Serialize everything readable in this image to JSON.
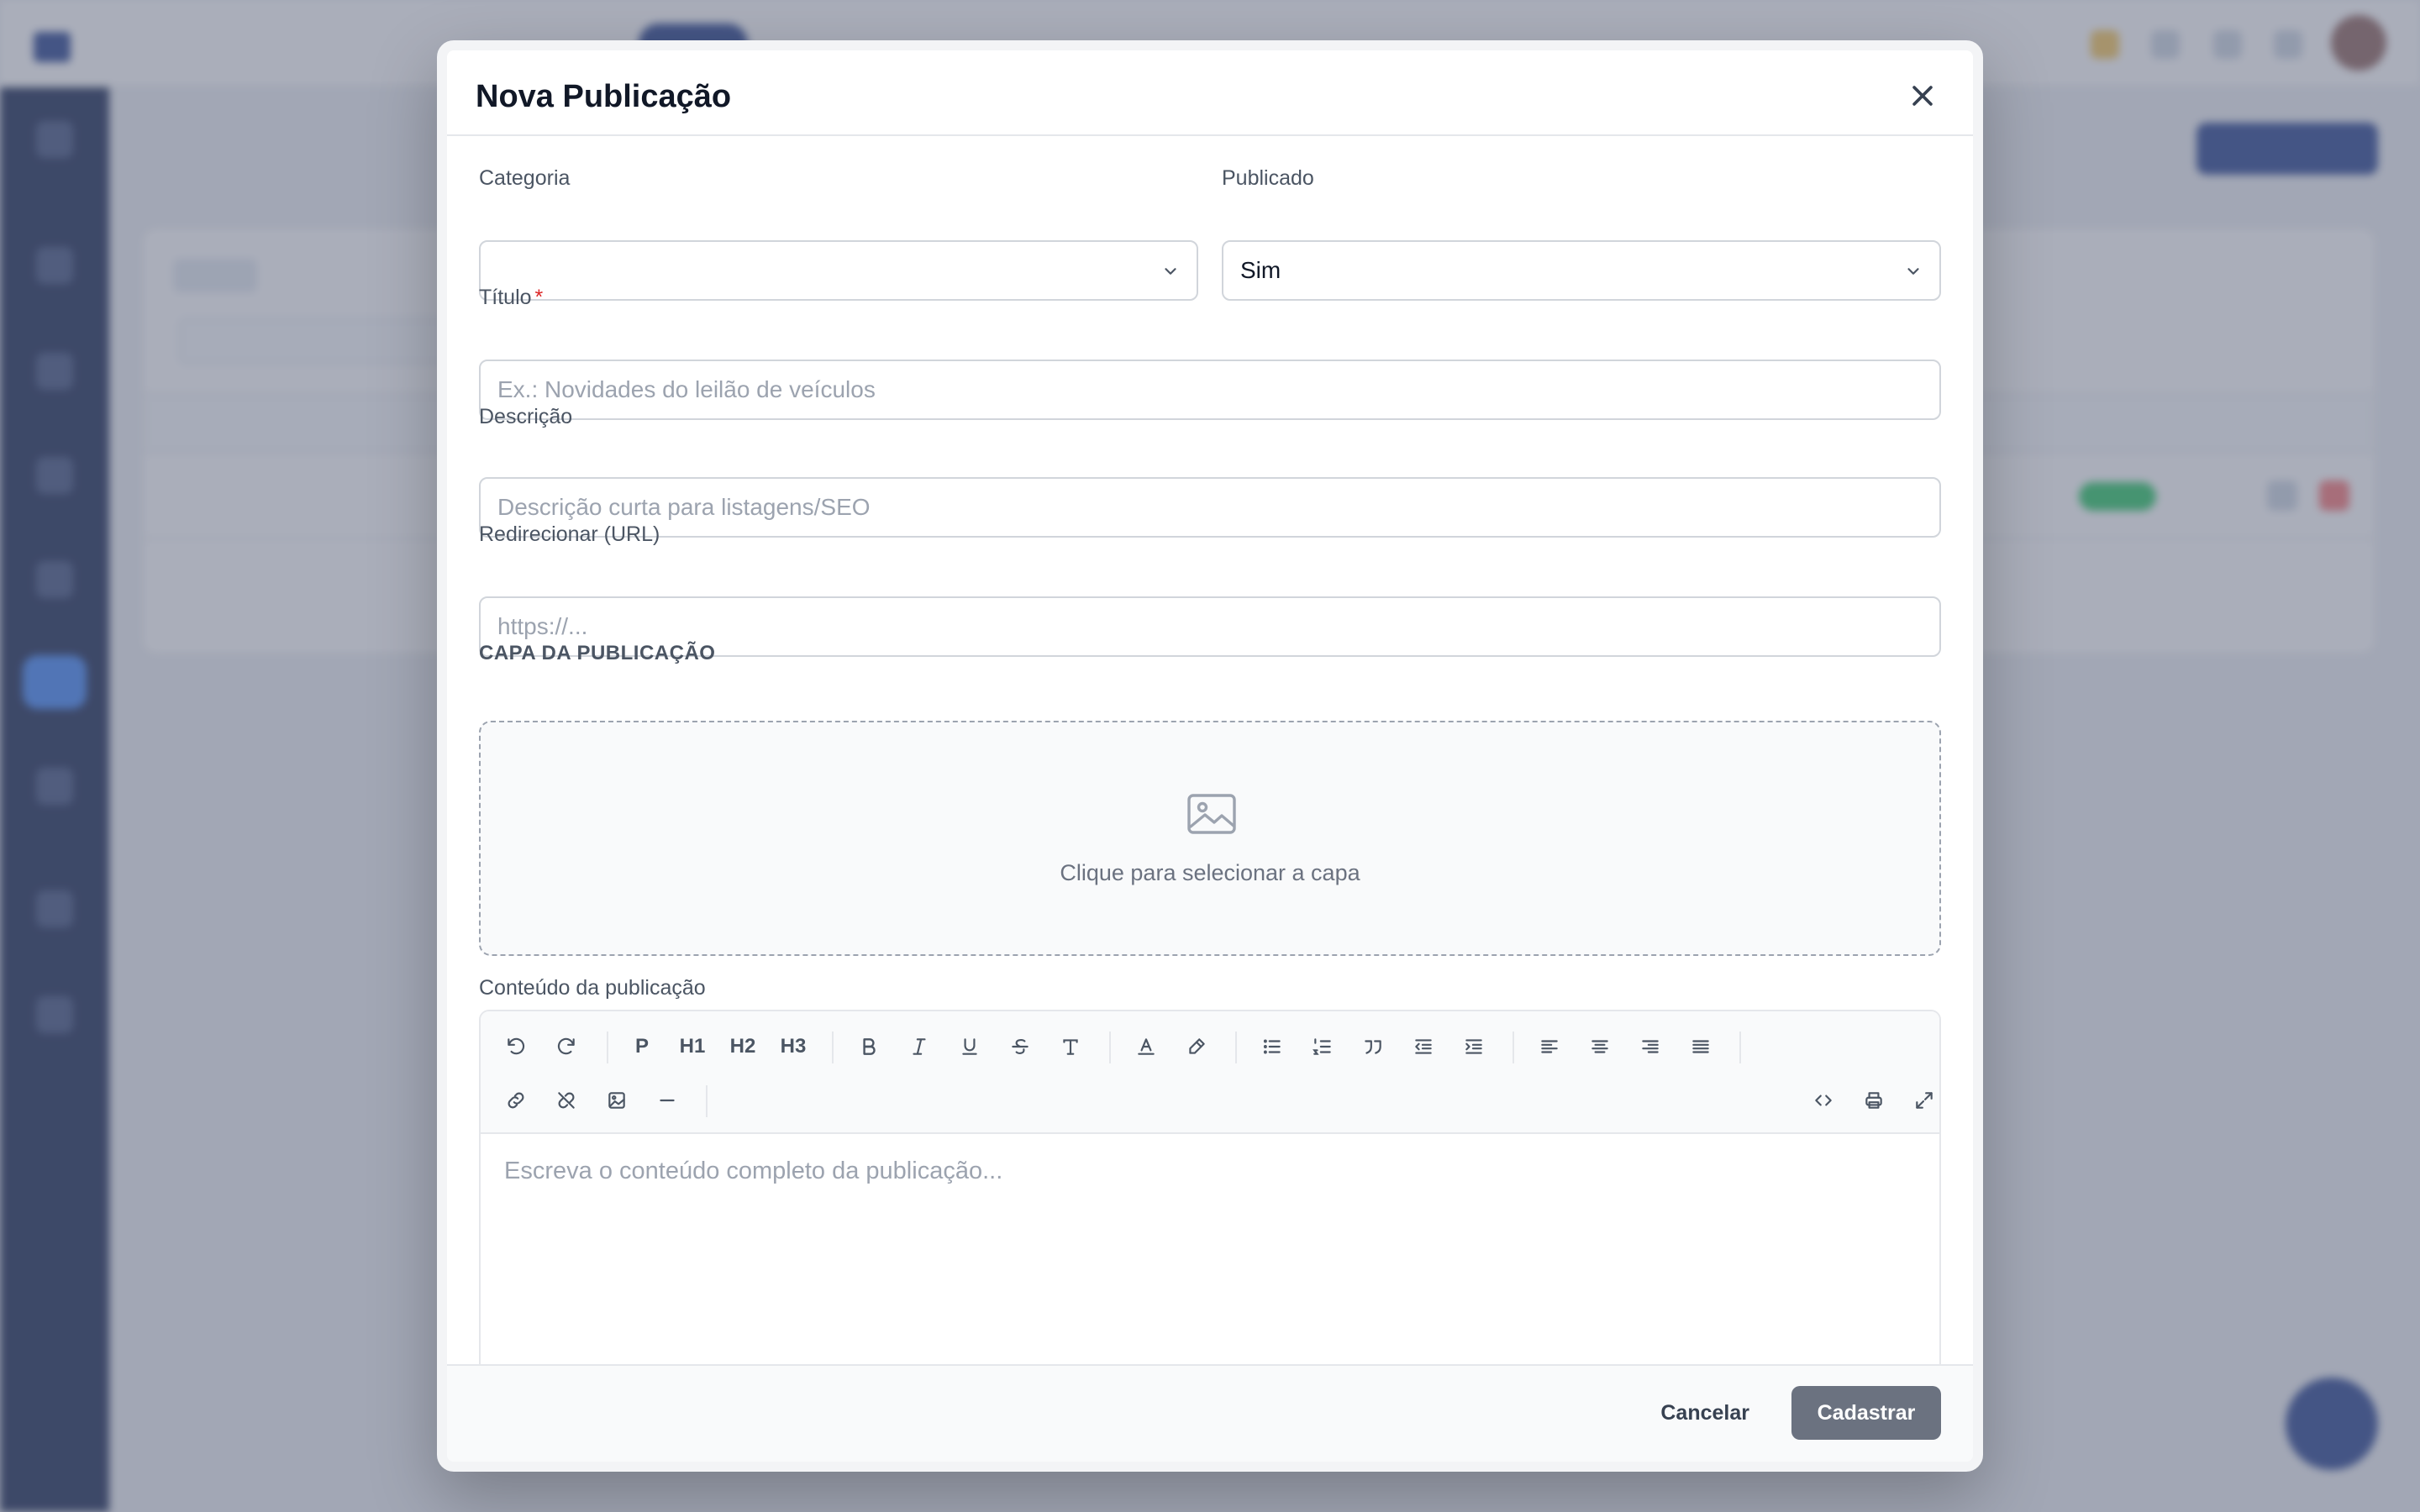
{
  "modal": {
    "title": "Nova Publicação",
    "close_label": "×"
  },
  "form": {
    "categoria": {
      "label": "Categoria",
      "value": ""
    },
    "publicado": {
      "label": "Publicado",
      "value": "Sim",
      "options": [
        "Sim"
      ]
    },
    "titulo": {
      "label": "Título",
      "required_mark": "*",
      "placeholder": "Ex.: Novidades do leilão de veículos"
    },
    "descricao": {
      "label": "Descrição",
      "placeholder": "Descrição curta para listagens/SEO"
    },
    "redirecionar": {
      "label": "Redirecionar (URL)",
      "placeholder": "https://..."
    },
    "capa": {
      "section_title": "CAPA DA PUBLICAÇÃO",
      "dropzone_text": "Clique para selecionar a capa"
    },
    "conteudo": {
      "label": "Conteúdo da publicação",
      "placeholder": "Escreva o conteúdo completo da publicação...",
      "toolbar": {
        "p": "P",
        "h1": "H1",
        "h2": "H2",
        "h3": "H3"
      }
    }
  },
  "footer": {
    "cancel_label": "Cancelar",
    "submit_label": "Cadastrar"
  },
  "colors": {
    "primary": "#1e3a8a",
    "submit_disabled": "#6b7280",
    "required": "#dc2626",
    "sidebar": "#0f1f4a"
  },
  "icons": [
    "close-icon",
    "chevron-down-icon",
    "image-icon",
    "undo-icon",
    "redo-icon",
    "bold-icon",
    "italic-icon",
    "underline-icon",
    "strikethrough-icon",
    "clear-format-icon",
    "text-color-icon",
    "highlight-icon",
    "bullet-list-icon",
    "ordered-list-icon",
    "blockquote-icon",
    "outdent-icon",
    "indent-icon",
    "align-left-icon",
    "align-center-icon",
    "align-right-icon",
    "align-justify-icon",
    "link-icon",
    "unlink-icon",
    "insert-image-icon",
    "horizontal-rule-icon",
    "code-view-icon",
    "print-icon",
    "fullscreen-icon"
  ]
}
